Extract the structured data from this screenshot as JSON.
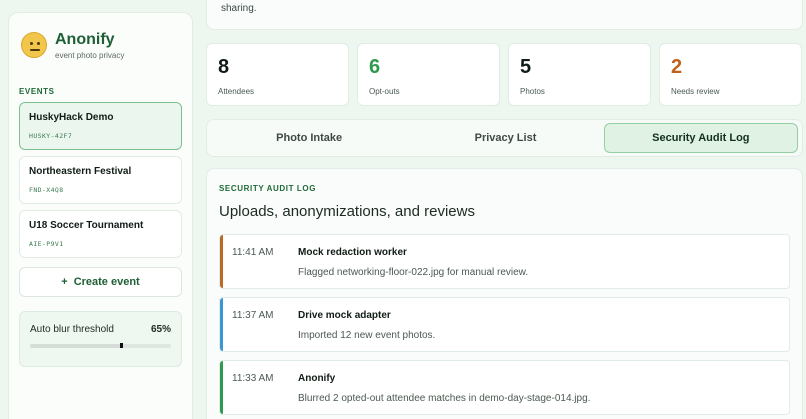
{
  "app": {
    "name": "Anonify",
    "tagline": "event photo privacy"
  },
  "sidebar": {
    "section_label": "EVENTS",
    "events": [
      {
        "name": "HuskyHack Demo",
        "code": "HUSKY-42F7",
        "active": true
      },
      {
        "name": "Northeastern Festival",
        "code": "FND-X4Q8",
        "active": false
      },
      {
        "name": "U18 Soccer Tournament",
        "code": "AIE-P9V1",
        "active": false
      }
    ],
    "create_button": {
      "icon": "plus",
      "label": "Create event"
    },
    "threshold": {
      "label": "Auto blur threshold",
      "value_text": "65%",
      "value": 0.65
    }
  },
  "banner": {
    "text": "sharing."
  },
  "stats": [
    {
      "value": "8",
      "label": "Attendees",
      "color": "#111c15"
    },
    {
      "value": "6",
      "label": "Opt-outs",
      "color": "#2e9a4f"
    },
    {
      "value": "5",
      "label": "Photos",
      "color": "#111c15"
    },
    {
      "value": "2",
      "label": "Needs review",
      "color": "#c0611e"
    }
  ],
  "tabs": [
    {
      "label": "Photo Intake",
      "active": false
    },
    {
      "label": "Privacy List",
      "active": false
    },
    {
      "label": "Security Audit Log",
      "active": true
    }
  ],
  "audit": {
    "kicker": "SECURITY AUDIT LOG",
    "title": "Uploads, anonymizations, and reviews",
    "entries": [
      {
        "time": "11:41 AM",
        "actor": "Mock redaction worker",
        "message": "Flagged networking-floor-022.jpg for manual review.",
        "accent": "#b9692a"
      },
      {
        "time": "11:37 AM",
        "actor": "Drive mock adapter",
        "message": "Imported 12 new event photos.",
        "accent": "#3a97d4"
      },
      {
        "time": "11:33 AM",
        "actor": "Anonify",
        "message": "Blurred 2 opted-out attendee matches in demo-day-stage-014.jpg.",
        "accent": "#2e9a4f"
      }
    ]
  }
}
